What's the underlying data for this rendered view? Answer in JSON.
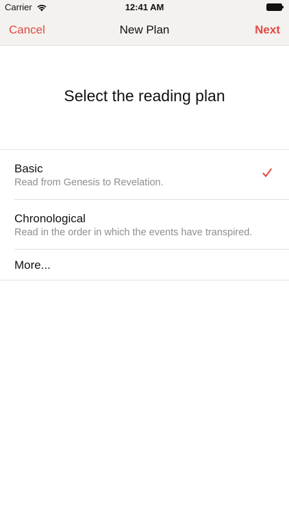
{
  "status_bar": {
    "carrier": "Carrier",
    "time": "12:41 AM",
    "wifi_icon": "wifi-icon",
    "battery_icon": "battery-icon"
  },
  "nav": {
    "cancel_label": "Cancel",
    "title": "New Plan",
    "next_label": "Next",
    "accent_color": "#e04a46"
  },
  "heading": "Select the reading plan",
  "plans": [
    {
      "title": "Basic",
      "subtitle": "Read from Genesis to Revelation.",
      "selected": true,
      "selected_icon": "checkmark-icon"
    },
    {
      "title": "Chronological",
      "subtitle": "Read in the order in which the events have transpired.",
      "selected": false
    },
    {
      "title": "More...",
      "selected": false
    }
  ]
}
